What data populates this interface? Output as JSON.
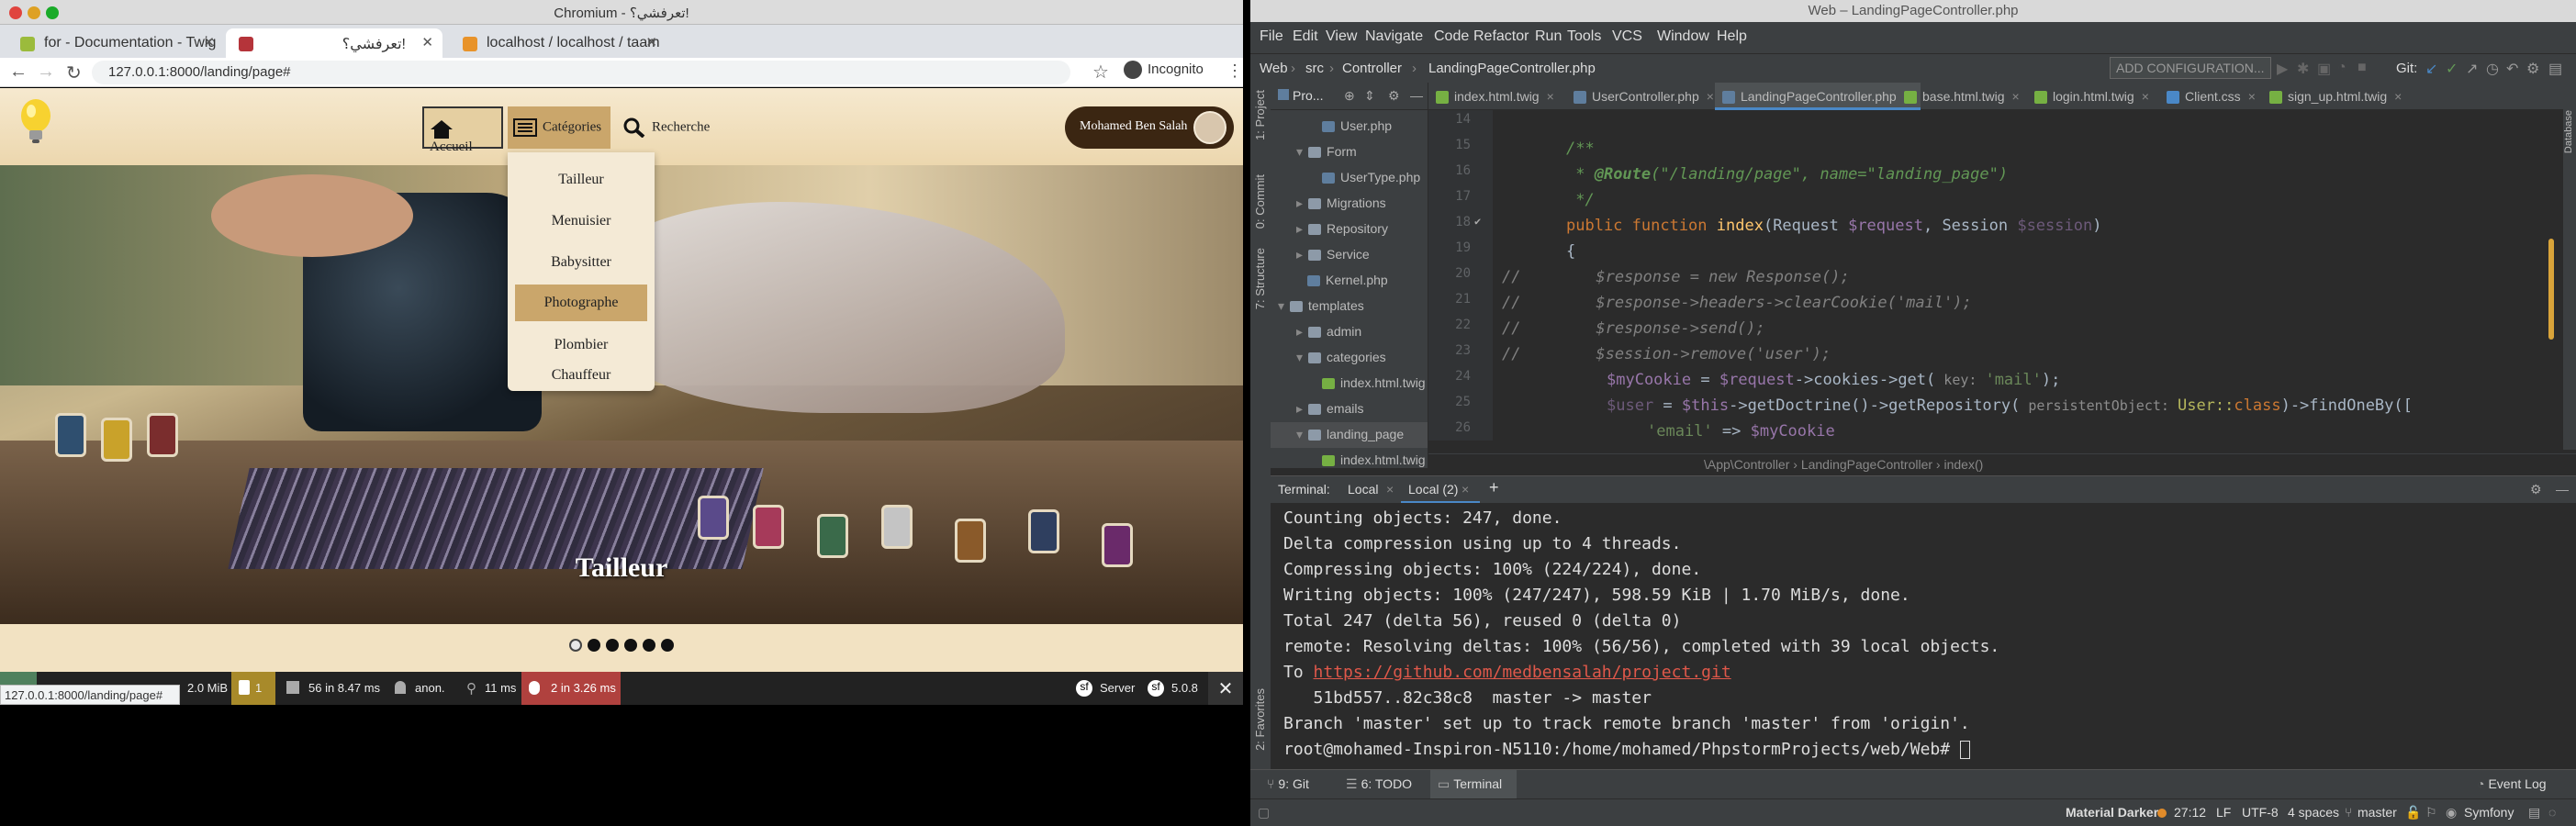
{
  "browser": {
    "window_title": "Chromium - تعرفشي؟!",
    "tabs": [
      {
        "label": "for - Documentation - Twig"
      },
      {
        "label": "تعرفشي؟!"
      },
      {
        "label": "localhost / localhost / taam"
      }
    ],
    "address": "127.0.0.1:8000/landing/page#",
    "incognito_label": "Incognito",
    "page": {
      "nav": {
        "home_label": "Accueil",
        "categories_label": "Catégories",
        "search_label": "Recherche"
      },
      "user_name": "Mohamed Ben Salah",
      "categories": [
        {
          "label": "Tailleur"
        },
        {
          "label": "Menuisier"
        },
        {
          "label": "Babysitter"
        },
        {
          "label": "Photographe"
        },
        {
          "label": "Plombier"
        },
        {
          "label": "Chauffeur"
        }
      ],
      "selected_category": "Photographe",
      "hero_caption": "Tailleur",
      "carousel_count": 6,
      "carousel_active_index": 0
    },
    "symfony_toolbar": {
      "memory": "2.0 MiB",
      "warnings": "1",
      "cache": "56 in 8.47 ms",
      "user": "anon.",
      "time": "11 ms",
      "db": "2 in 3.26 ms",
      "server": "Server",
      "version": "5.0.8"
    },
    "status_url": "127.0.0.1:8000/landing/page#"
  },
  "ide": {
    "window_title": "Web – LandingPageController.php",
    "menu": [
      "File",
      "Edit",
      "View",
      "Navigate",
      "Code",
      "Refactor",
      "Run",
      "Tools",
      "VCS",
      "Window",
      "Help"
    ],
    "breadcrumb_nav": [
      "Web",
      "src",
      "Controller",
      "LandingPageController.php"
    ],
    "add_configuration": "ADD CONFIGURATION...",
    "git_label": "Git:",
    "project_label": "Pro...",
    "tree": [
      {
        "label": "User.php",
        "type": "php"
      },
      {
        "label": "Form",
        "type": "folder"
      },
      {
        "label": "UserType.php",
        "type": "php"
      },
      {
        "label": "Migrations",
        "type": "folder"
      },
      {
        "label": "Repository",
        "type": "folder"
      },
      {
        "label": "Service",
        "type": "folder"
      },
      {
        "label": "Kernel.php",
        "type": "php"
      },
      {
        "label": "templates",
        "type": "folder"
      },
      {
        "label": "admin",
        "type": "folder"
      },
      {
        "label": "categories",
        "type": "folder"
      },
      {
        "label": "index.html.twig",
        "type": "twig"
      },
      {
        "label": "emails",
        "type": "folder"
      },
      {
        "label": "landing_page",
        "type": "folder"
      },
      {
        "label": "index.html.twig",
        "type": "twig"
      }
    ],
    "editor_tabs": [
      {
        "label": "index.html.twig"
      },
      {
        "label": "UserController.php"
      },
      {
        "label": "LandingPageController.php"
      },
      {
        "label": "base.html.twig"
      },
      {
        "label": "login.html.twig"
      },
      {
        "label": "Client.css"
      },
      {
        "label": "sign_up.html.twig"
      }
    ],
    "line_numbers": [
      "14",
      "15",
      "16",
      "17",
      "18",
      "19",
      "20",
      "21",
      "22",
      "23",
      "24",
      "25",
      "26"
    ],
    "code": {
      "l15": "/**",
      "l16_a": " * ",
      "l16_b": "@Route",
      "l16_c": "(\"/landing/page\", name=\"landing_page\")",
      "l17": " */",
      "l18_kw": "public function ",
      "l18_fn": "index",
      "l18_rest1": "(Request ",
      "l18_var1": "$request",
      "l18_rest2": ", Session ",
      "l18_var2": "$session",
      "l18_rest3": ")",
      "l19": "{",
      "l20": "//        $response = new Response();",
      "l21": "//        $response->headers->clearCookie('mail');",
      "l22": "//        $response->send();",
      "l23": "//        $session->remove('user');",
      "l24_var": "$myCookie",
      "l24_mid": " = ",
      "l24_var2": "$request",
      "l24_rest": "->cookies->get(",
      "l24_hint": " key: ",
      "l24_str": "'mail'",
      "l24_end": ");",
      "l25_var": "$user",
      "l25_mid": " = ",
      "l25_this": "$this",
      "l25_rest": "->getDoctrine()->getRepository(",
      "l25_hint": " persistentObject: ",
      "l25_cls": "User::",
      "l25_kw": "class",
      "l25_end": ")->findOneBy([",
      "l26_str": "'email'",
      "l26_mid": " => ",
      "l26_var": "$myCookie"
    },
    "code_breadcrumb": "\\App\\Controller   ›   LandingPageController   ›   index()",
    "terminal": {
      "label": "Terminal:",
      "tabs": [
        "Local",
        "Local (2)"
      ],
      "lines": [
        "Counting objects: 247, done.",
        "Delta compression using up to 4 threads.",
        "Compressing objects: 100% (224/224), done.",
        "Writing objects: 100% (247/247), 598.59 KiB | 1.70 MiB/s, done.",
        "Total 247 (delta 56), reused 0 (delta 0)",
        "remote: Resolving deltas: 100% (56/56), completed with 39 local objects."
      ],
      "to_prefix": "To ",
      "to_link": "https://github.com/medbensalah/project.git",
      "push_line": "   51bd557..82c38c8  master -> master",
      "branch_line": "Branch 'master' set up to track remote branch 'master' from 'origin'.",
      "prompt": "root@mohamed-Inspiron-N5110:/home/mohamed/PhpstormProjects/web/Web# "
    },
    "bottom_tools": [
      {
        "label": "9: Git"
      },
      {
        "label": "6: TODO"
      },
      {
        "label": "Terminal"
      }
    ],
    "event_log": "Event Log",
    "status": {
      "theme": "Material Darker",
      "position": "27:12",
      "line_sep": "LF",
      "encoding": "UTF-8",
      "indent": "4 spaces",
      "branch": "master",
      "framework": "Symfony"
    },
    "side_labels": {
      "project": "1: Project",
      "commit": "0: Commit",
      "structure": "7: Structure",
      "favorites": "2: Favorites",
      "database": "Database"
    }
  }
}
